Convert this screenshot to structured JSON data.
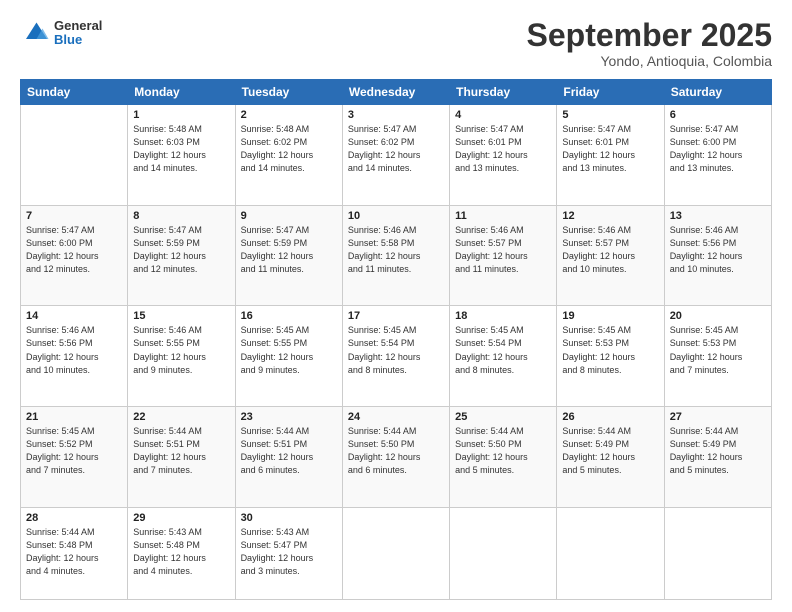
{
  "logo": {
    "general": "General",
    "blue": "Blue"
  },
  "header": {
    "month": "September 2025",
    "location": "Yondo, Antioquia, Colombia"
  },
  "days_of_week": [
    "Sunday",
    "Monday",
    "Tuesday",
    "Wednesday",
    "Thursday",
    "Friday",
    "Saturday"
  ],
  "weeks": [
    [
      {
        "day": "",
        "info": ""
      },
      {
        "day": "1",
        "info": "Sunrise: 5:48 AM\nSunset: 6:03 PM\nDaylight: 12 hours\nand 14 minutes."
      },
      {
        "day": "2",
        "info": "Sunrise: 5:48 AM\nSunset: 6:02 PM\nDaylight: 12 hours\nand 14 minutes."
      },
      {
        "day": "3",
        "info": "Sunrise: 5:47 AM\nSunset: 6:02 PM\nDaylight: 12 hours\nand 14 minutes."
      },
      {
        "day": "4",
        "info": "Sunrise: 5:47 AM\nSunset: 6:01 PM\nDaylight: 12 hours\nand 13 minutes."
      },
      {
        "day": "5",
        "info": "Sunrise: 5:47 AM\nSunset: 6:01 PM\nDaylight: 12 hours\nand 13 minutes."
      },
      {
        "day": "6",
        "info": "Sunrise: 5:47 AM\nSunset: 6:00 PM\nDaylight: 12 hours\nand 13 minutes."
      }
    ],
    [
      {
        "day": "7",
        "info": "Sunrise: 5:47 AM\nSunset: 6:00 PM\nDaylight: 12 hours\nand 12 minutes."
      },
      {
        "day": "8",
        "info": "Sunrise: 5:47 AM\nSunset: 5:59 PM\nDaylight: 12 hours\nand 12 minutes."
      },
      {
        "day": "9",
        "info": "Sunrise: 5:47 AM\nSunset: 5:59 PM\nDaylight: 12 hours\nand 11 minutes."
      },
      {
        "day": "10",
        "info": "Sunrise: 5:46 AM\nSunset: 5:58 PM\nDaylight: 12 hours\nand 11 minutes."
      },
      {
        "day": "11",
        "info": "Sunrise: 5:46 AM\nSunset: 5:57 PM\nDaylight: 12 hours\nand 11 minutes."
      },
      {
        "day": "12",
        "info": "Sunrise: 5:46 AM\nSunset: 5:57 PM\nDaylight: 12 hours\nand 10 minutes."
      },
      {
        "day": "13",
        "info": "Sunrise: 5:46 AM\nSunset: 5:56 PM\nDaylight: 12 hours\nand 10 minutes."
      }
    ],
    [
      {
        "day": "14",
        "info": "Sunrise: 5:46 AM\nSunset: 5:56 PM\nDaylight: 12 hours\nand 10 minutes."
      },
      {
        "day": "15",
        "info": "Sunrise: 5:46 AM\nSunset: 5:55 PM\nDaylight: 12 hours\nand 9 minutes."
      },
      {
        "day": "16",
        "info": "Sunrise: 5:45 AM\nSunset: 5:55 PM\nDaylight: 12 hours\nand 9 minutes."
      },
      {
        "day": "17",
        "info": "Sunrise: 5:45 AM\nSunset: 5:54 PM\nDaylight: 12 hours\nand 8 minutes."
      },
      {
        "day": "18",
        "info": "Sunrise: 5:45 AM\nSunset: 5:54 PM\nDaylight: 12 hours\nand 8 minutes."
      },
      {
        "day": "19",
        "info": "Sunrise: 5:45 AM\nSunset: 5:53 PM\nDaylight: 12 hours\nand 8 minutes."
      },
      {
        "day": "20",
        "info": "Sunrise: 5:45 AM\nSunset: 5:53 PM\nDaylight: 12 hours\nand 7 minutes."
      }
    ],
    [
      {
        "day": "21",
        "info": "Sunrise: 5:45 AM\nSunset: 5:52 PM\nDaylight: 12 hours\nand 7 minutes."
      },
      {
        "day": "22",
        "info": "Sunrise: 5:44 AM\nSunset: 5:51 PM\nDaylight: 12 hours\nand 7 minutes."
      },
      {
        "day": "23",
        "info": "Sunrise: 5:44 AM\nSunset: 5:51 PM\nDaylight: 12 hours\nand 6 minutes."
      },
      {
        "day": "24",
        "info": "Sunrise: 5:44 AM\nSunset: 5:50 PM\nDaylight: 12 hours\nand 6 minutes."
      },
      {
        "day": "25",
        "info": "Sunrise: 5:44 AM\nSunset: 5:50 PM\nDaylight: 12 hours\nand 5 minutes."
      },
      {
        "day": "26",
        "info": "Sunrise: 5:44 AM\nSunset: 5:49 PM\nDaylight: 12 hours\nand 5 minutes."
      },
      {
        "day": "27",
        "info": "Sunrise: 5:44 AM\nSunset: 5:49 PM\nDaylight: 12 hours\nand 5 minutes."
      }
    ],
    [
      {
        "day": "28",
        "info": "Sunrise: 5:44 AM\nSunset: 5:48 PM\nDaylight: 12 hours\nand 4 minutes."
      },
      {
        "day": "29",
        "info": "Sunrise: 5:43 AM\nSunset: 5:48 PM\nDaylight: 12 hours\nand 4 minutes."
      },
      {
        "day": "30",
        "info": "Sunrise: 5:43 AM\nSunset: 5:47 PM\nDaylight: 12 hours\nand 3 minutes."
      },
      {
        "day": "",
        "info": ""
      },
      {
        "day": "",
        "info": ""
      },
      {
        "day": "",
        "info": ""
      },
      {
        "day": "",
        "info": ""
      }
    ]
  ]
}
